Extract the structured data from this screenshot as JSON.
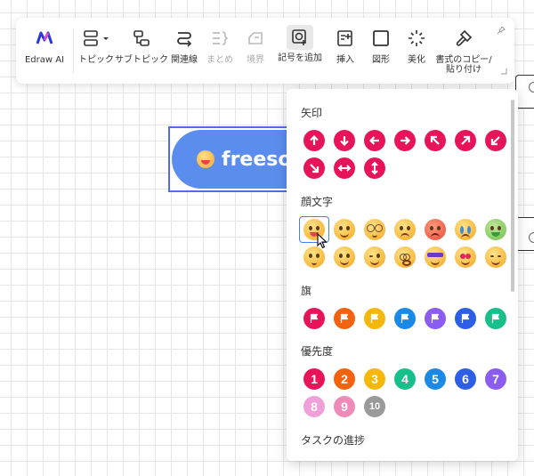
{
  "toolbar": {
    "buttons": [
      {
        "label": "Edraw AI",
        "icon": "edraw-ai-icon"
      },
      {
        "label": "トピック",
        "icon": "topic-icon"
      },
      {
        "label": "サブトピック",
        "icon": "subtopic-icon"
      },
      {
        "label": "関連線",
        "icon": "relation-line-icon"
      },
      {
        "label": "まとめ",
        "icon": "summary-icon",
        "disabled": true
      },
      {
        "label": "境界",
        "icon": "boundary-icon",
        "disabled": true
      },
      {
        "label": "記号を追加",
        "icon": "add-symbol-icon",
        "active": true
      },
      {
        "label": "挿入",
        "icon": "insert-icon"
      },
      {
        "label": "図形",
        "icon": "shape-icon"
      },
      {
        "label": "美化",
        "icon": "beautify-icon"
      },
      {
        "label": "書式のコピー/\n貼り付け",
        "icon": "format-painter-icon"
      }
    ]
  },
  "canvas": {
    "topic_text": "freesoft"
  },
  "panel": {
    "sections": {
      "arrows": "矢印",
      "faces": "顔文字",
      "flags": "旗",
      "priority": "優先度",
      "progress": "タスクの進捗"
    },
    "arrow_icons": [
      "arrow-up-icon",
      "arrow-down-icon",
      "arrow-left-icon",
      "arrow-right-icon",
      "arrow-up-left-icon",
      "arrow-up-right-icon",
      "arrow-down-left-icon",
      "arrow-down-right-icon",
      "arrow-left-right-icon",
      "arrow-up-down-icon"
    ],
    "flag_colors": [
      "#e8145a",
      "#f2620f",
      "#f5b80a",
      "#1a8ae6",
      "#8a5cf0",
      "#2d5ee6",
      "#17c08a"
    ],
    "priority_numbers": [
      "1",
      "2",
      "3",
      "4",
      "5",
      "6",
      "7",
      "8",
      "9",
      "10"
    ],
    "priority_colors": [
      "#e8145a",
      "#f2620f",
      "#f5b80a",
      "#17c08a",
      "#1a8ae6",
      "#2d5ee6",
      "#8a5cf0",
      "#f0a0d8",
      "#f08ab8",
      "#9a9a9a"
    ]
  },
  "colors": {
    "accent": "#5b8def",
    "arrow_red": "#e8145a",
    "selection": "#4a7ee8"
  }
}
